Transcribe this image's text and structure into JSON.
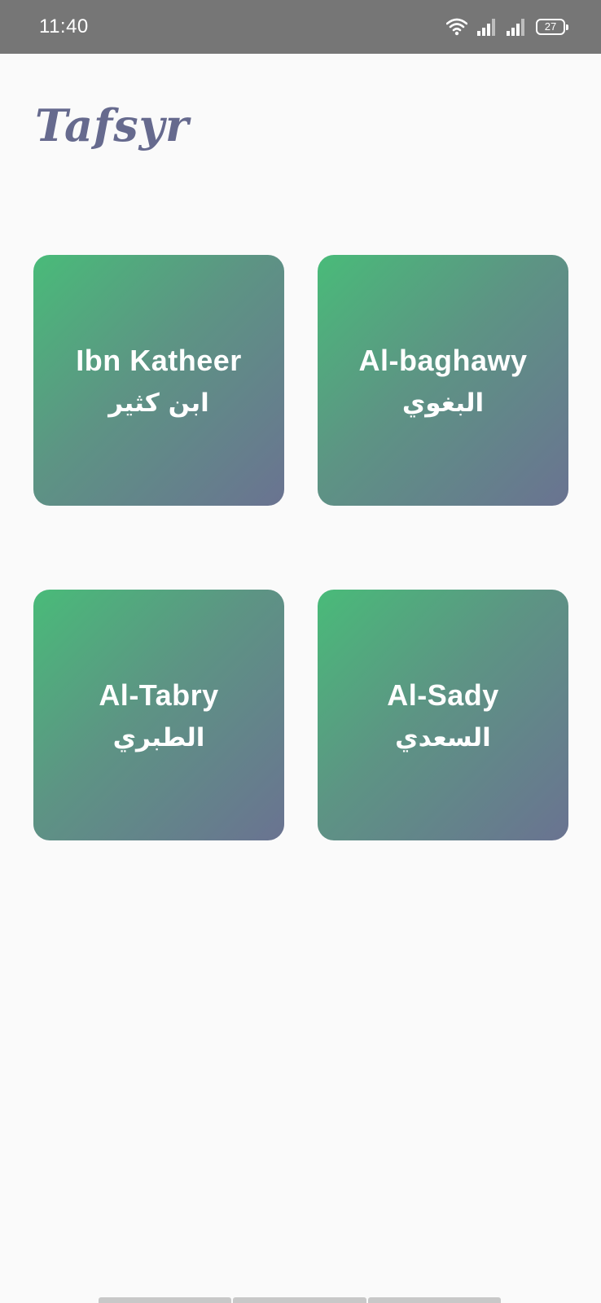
{
  "status_bar": {
    "time": "11:40",
    "battery": "27",
    "icons": [
      "wifi-icon",
      "signal-icon",
      "signal-icon",
      "battery-icon"
    ]
  },
  "app": {
    "title": "Tafsyr"
  },
  "tafsir_cards": [
    {
      "name_en": "Ibn Katheer",
      "name_ar": "ابن كثير"
    },
    {
      "name_en": "Al-baghawy",
      "name_ar": "البغوي"
    },
    {
      "name_en": "Al-Tabry",
      "name_ar": "الطبري"
    },
    {
      "name_en": "Al-Sady",
      "name_ar": "السعدي"
    }
  ],
  "colors": {
    "status_bar": "#767676",
    "background": "#fafafa",
    "title": "#666a8e",
    "card_gradient_start": "#49bb79",
    "card_gradient_end": "#6a7391"
  }
}
